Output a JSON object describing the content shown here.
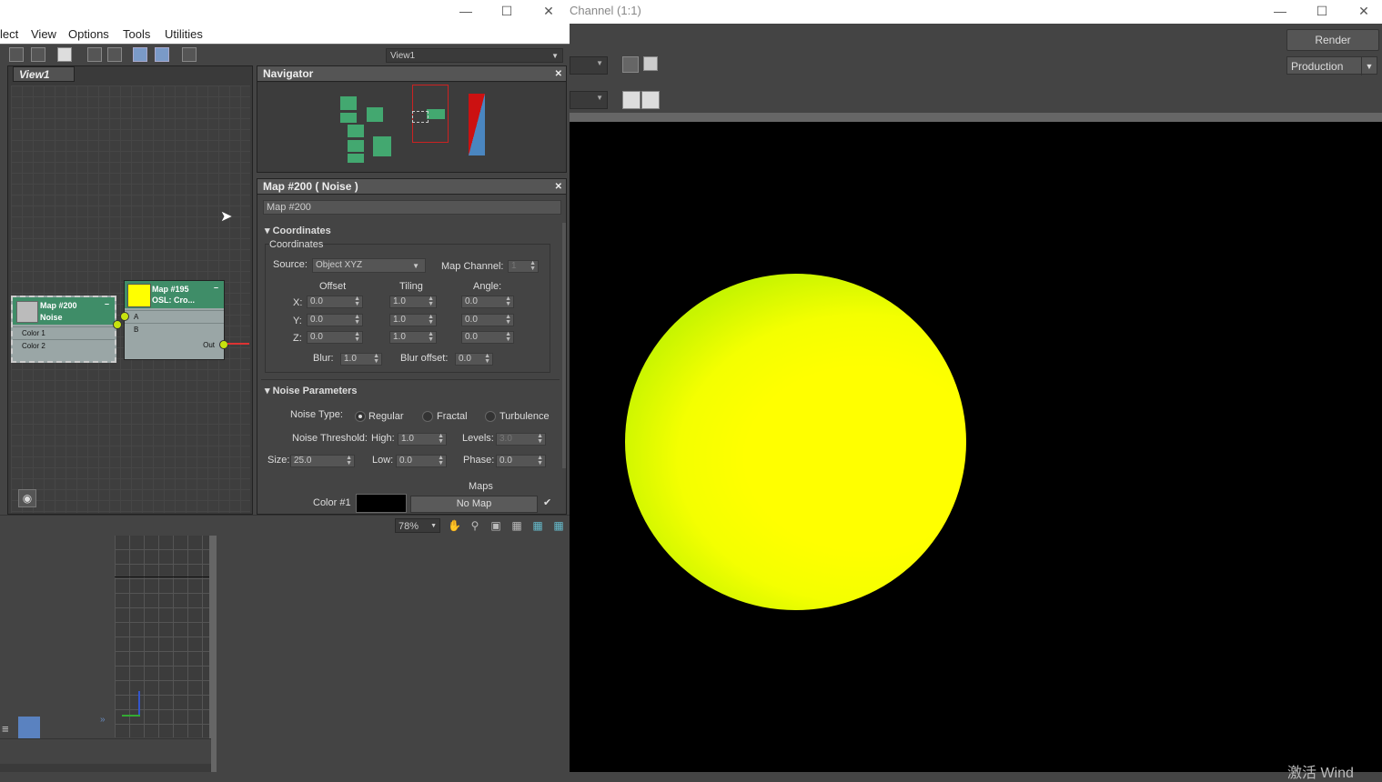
{
  "render_window": {
    "title": "Channel (1:1)",
    "render_button": "Render",
    "production_combo": "Production",
    "watermark": "激活 Wind"
  },
  "slate": {
    "menu": [
      "lect",
      "View",
      "Options",
      "Tools",
      "Utilities"
    ],
    "view_combo": "View1",
    "view_tab": "View1",
    "zoom": "78%"
  },
  "nodes": {
    "noise": {
      "title_line1": "Map #200",
      "title_line2": "Noise",
      "port1": "Color 1",
      "port2": "Color 2"
    },
    "osl": {
      "title_line1": "Map #195",
      "title_line2": "OSL: Cro...",
      "port_a": "A",
      "port_b": "B",
      "port_out": "Out"
    }
  },
  "navigator": {
    "title": "Navigator"
  },
  "params": {
    "title": "Map #200  ( Noise )",
    "name_field": "Map #200",
    "coords_rollout": "Coordinates",
    "coords_group": "Coordinates",
    "source_label": "Source:",
    "source_value": "Object XYZ",
    "map_channel_label": "Map Channel:",
    "map_channel_value": "1",
    "offset_label": "Offset",
    "tiling_label": "Tiling",
    "angle_label": "Angle:",
    "axis_x": "X:",
    "axis_y": "Y:",
    "axis_z": "Z:",
    "offset": [
      "0.0",
      "0.0",
      "0.0"
    ],
    "tiling": [
      "1.0",
      "1.0",
      "1.0"
    ],
    "angle": [
      "0.0",
      "0.0",
      "0.0"
    ],
    "blur_label": "Blur:",
    "blur_value": "1.0",
    "blur_offset_label": "Blur offset:",
    "blur_offset_value": "0.0",
    "noise_rollout": "Noise Parameters",
    "noise_type_label": "Noise Type:",
    "noise_types": [
      "Regular",
      "Fractal",
      "Turbulence"
    ],
    "noise_threshold_label": "Noise Threshold:",
    "high_label": "High:",
    "high_value": "1.0",
    "levels_label": "Levels:",
    "levels_value": "3.0",
    "size_label": "Size:",
    "size_value": "25.0",
    "low_label": "Low:",
    "low_value": "0.0",
    "phase_label": "Phase:",
    "phase_value": "0.0",
    "maps_label": "Maps",
    "color1_label": "Color #1",
    "color1_map": "No Map"
  },
  "colors": {
    "noise_node_header": "#3f8d68",
    "sphere": "#ffff00",
    "accent_icon": "#7a9ac8"
  }
}
